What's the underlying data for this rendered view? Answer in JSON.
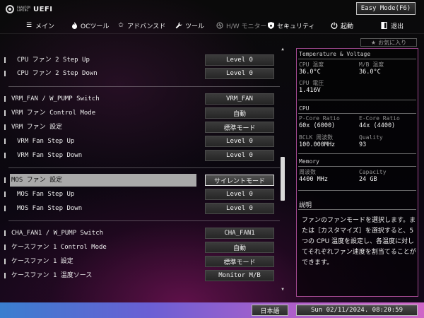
{
  "header": {
    "logo_small": [
      "PHANTOM",
      "GAMING"
    ],
    "logo_text": "UEFI",
    "easy_mode_label": "Easy Mode(F6)"
  },
  "tabs": [
    {
      "label": "メイン",
      "icon": "menu-icon"
    },
    {
      "label": "OCツール",
      "icon": "flame-icon"
    },
    {
      "label": "アドバンスド",
      "icon": "star-icon"
    },
    {
      "label": "ツール",
      "icon": "wrench-icon"
    },
    {
      "label": "H/W モニター",
      "icon": "hw-monitor-icon",
      "active": true
    },
    {
      "label": "セキュリティ",
      "icon": "shield-icon"
    },
    {
      "label": "起動",
      "icon": "power-icon"
    },
    {
      "label": "退出",
      "icon": "exit-icon"
    }
  ],
  "favorites_label": "お気に入り",
  "settings": [
    {
      "label": "CPU ファン 2 Step Up",
      "value": "Level 0",
      "indent": true
    },
    {
      "label": "CPU ファン 2 Step Down",
      "value": "Level 0",
      "indent": true
    },
    {
      "label": "VRM_FAN / W_PUMP Switch",
      "value": "VRM_FAN",
      "indent": false
    },
    {
      "label": "VRM ファン Control Mode",
      "value": "自動",
      "indent": false
    },
    {
      "label": "VRM ファン 設定",
      "value": "標準モード",
      "indent": false
    },
    {
      "label": "VRM Fan Step Up",
      "value": "Level 0",
      "indent": true
    },
    {
      "label": "VRM Fan Step Down",
      "value": "Level 0",
      "indent": true
    },
    {
      "label": "MOS ファン 設定",
      "value": "サイレントモード",
      "indent": false,
      "selected": true
    },
    {
      "label": "MOS Fan Step Up",
      "value": "Level 0",
      "indent": true
    },
    {
      "label": "MOS Fan Step Down",
      "value": "Level 0",
      "indent": true
    },
    {
      "label": "CHA_FAN1 / W_PUMP Switch",
      "value": "CHA_FAN1",
      "indent": false
    },
    {
      "label": "ケースファン 1 Control Mode",
      "value": "自動",
      "indent": false
    },
    {
      "label": "ケースファン 1 設定",
      "value": "標準モード",
      "indent": false
    },
    {
      "label": "ケースファン 1 温度ソース",
      "value": "Monitor M/B",
      "indent": false
    }
  ],
  "monitor": {
    "temp_voltage_title": "Temperature & Voltage",
    "cpu_temp_label": "CPU 温度",
    "cpu_temp_value": "36.0°C",
    "mb_temp_label": "M/B 温度",
    "mb_temp_value": "36.0°C",
    "cpu_voltage_label": "CPU 電圧",
    "cpu_voltage_value": "1.416V",
    "cpu_title": "CPU",
    "pcore_label": "P-Core Ratio",
    "pcore_value": "60x (6000)",
    "ecore_label": "E-Core Ratio",
    "ecore_value": "44x (4400)",
    "bclk_label": "BCLK 周波数",
    "bclk_value": "100.000MHz",
    "quality_label": "Quality",
    "quality_value": "93",
    "memory_title": "Memory",
    "freq_label": "周波数",
    "freq_value": "4400 MHz",
    "capacity_label": "Capacity",
    "capacity_value": "24 GB"
  },
  "description": {
    "title": "説明",
    "text": "ファンのファンモードを選択します。または［カスタマイズ］を選択すると、5 つの CPU 温度を設定し、各温度に対してそれぞれファン速度を割当てることができます。"
  },
  "footer": {
    "language": "日本語",
    "datetime": "Sun 02/11/2024. 08:20:59"
  }
}
